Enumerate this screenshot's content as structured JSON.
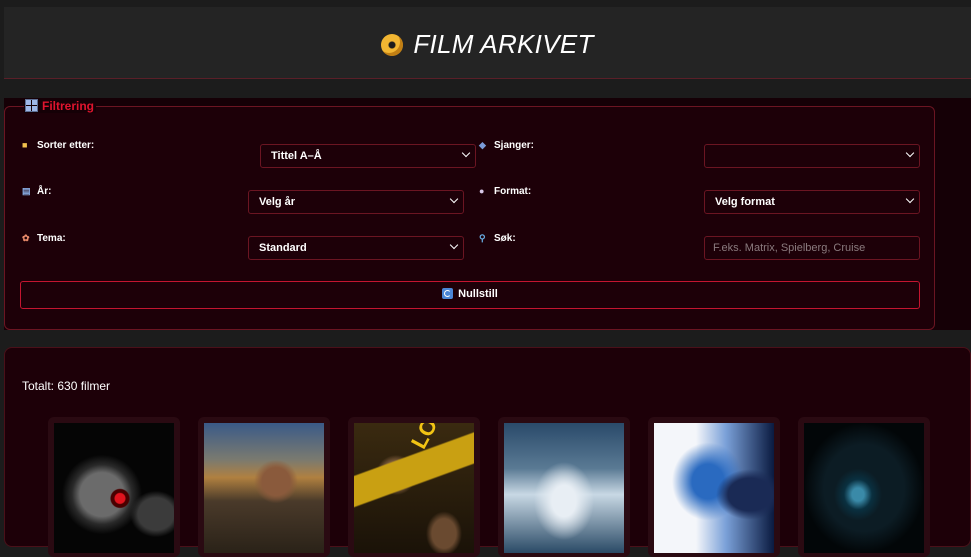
{
  "header": {
    "title": "FILM ARKIVET",
    "logo_icon": "disc-icon"
  },
  "filter": {
    "legend": "Filtrering",
    "legend_icon": "grid-icon",
    "sort": {
      "label": "Sorter etter:",
      "icon": "folder-icon",
      "value": "Tittel A–Å"
    },
    "genre": {
      "label": "Sjanger:",
      "icon": "masks-icon",
      "value": ""
    },
    "year": {
      "label": "År:",
      "icon": "calendar-icon",
      "value": "Velg år"
    },
    "format": {
      "label": "Format:",
      "icon": "dvd-icon",
      "value": "Velg format"
    },
    "theme": {
      "label": "Tema:",
      "icon": "palette-icon",
      "value": "Standard"
    },
    "search": {
      "label": "Søk:",
      "icon": "magnifier-icon",
      "value": "",
      "placeholder": "F.eks. Matrix, Spielberg, Cruise"
    },
    "reset_label": "Nullstill",
    "reset_icon": "refresh-icon"
  },
  "results": {
    "total_text": "Totalt: 630 filmer",
    "posters": [
      {
        "id": "movie-poster-1",
        "poster_text": ""
      },
      {
        "id": "movie-poster-2",
        "poster_text": ""
      },
      {
        "id": "movie-poster-3",
        "poster_text": "LOCKS"
      },
      {
        "id": "movie-poster-4",
        "poster_text": ""
      },
      {
        "id": "movie-poster-5",
        "poster_text": ""
      },
      {
        "id": "movie-poster-6",
        "poster_text": ""
      }
    ]
  },
  "colors": {
    "accent": "#e0142e",
    "border": "#6b1522",
    "panel": "#1d0008",
    "page": "#1c1c1c"
  }
}
